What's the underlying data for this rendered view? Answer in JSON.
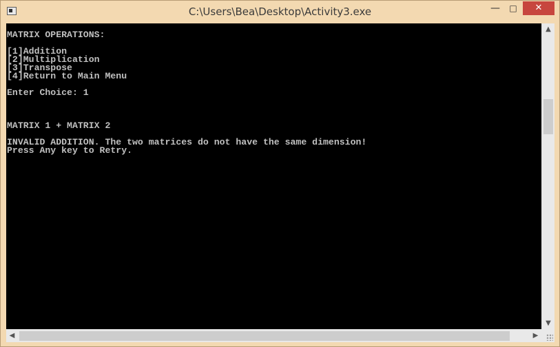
{
  "window": {
    "title": "C:\\Users\\Bea\\Desktop\\Activity3.exe",
    "controls": {
      "minimize": "—",
      "maximize": "□",
      "close": "✕"
    }
  },
  "console": {
    "lines": [
      "MATRIX OPERATIONS:",
      "",
      "[1]Addition",
      "[2]Multiplication",
      "[3]Transpose",
      "[4]Return to Main Menu",
      "",
      "Enter Choice: 1",
      "",
      "",
      "",
      "MATRIX 1 + MATRIX 2",
      "",
      "INVALID ADDITION. The two matrices do not have the same dimension!",
      "Press Any key to Retry."
    ]
  },
  "scrollbars": {
    "up_icon": "chevron-up-icon",
    "down_icon": "chevron-down-icon",
    "left_icon": "chevron-left-icon",
    "right_icon": "chevron-right-icon"
  },
  "colors": {
    "frame": "#f3d9b1",
    "close_button": "#c7463e",
    "console_bg": "#000000",
    "console_text": "#c0c0c0"
  }
}
